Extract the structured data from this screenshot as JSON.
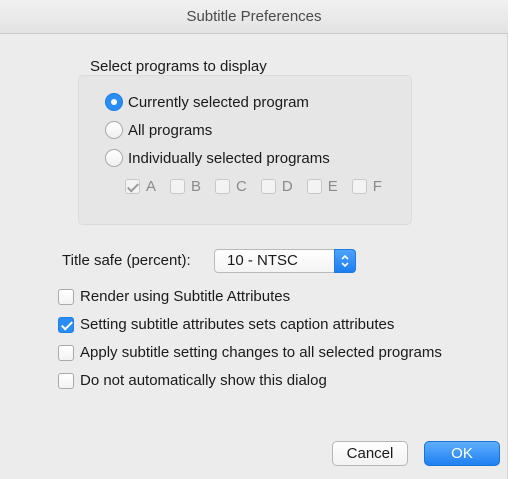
{
  "window": {
    "title": "Subtitle Preferences"
  },
  "programs": {
    "label": "Select programs to display",
    "options": [
      {
        "label": "Currently selected program",
        "selected": true
      },
      {
        "label": "All programs",
        "selected": false
      },
      {
        "label": "Individually selected programs",
        "selected": false
      }
    ],
    "channels": [
      {
        "label": "A",
        "checked": true
      },
      {
        "label": "B",
        "checked": false
      },
      {
        "label": "C",
        "checked": false
      },
      {
        "label": "D",
        "checked": false
      },
      {
        "label": "E",
        "checked": false
      },
      {
        "label": "F",
        "checked": false
      }
    ]
  },
  "title_safe": {
    "label": "Title safe (percent):",
    "value": "10 - NTSC"
  },
  "options": [
    {
      "label": "Render using Subtitle Attributes",
      "checked": false
    },
    {
      "label": "Setting subtitle attributes sets caption attributes",
      "checked": true
    },
    {
      "label": "Apply subtitle setting changes to all selected programs",
      "checked": false
    },
    {
      "label": "Do not automatically show this dialog",
      "checked": false
    }
  ],
  "buttons": {
    "cancel": "Cancel",
    "ok": "OK"
  },
  "colors": {
    "accent": "#2a8df6",
    "window_bg": "#ececec"
  }
}
